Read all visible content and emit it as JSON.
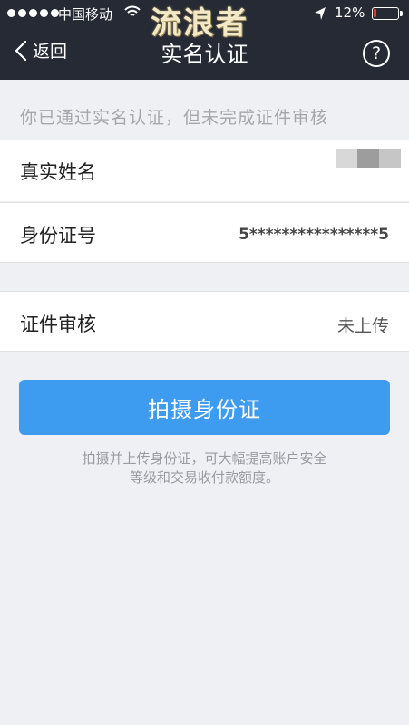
{
  "status_bar": {
    "carrier": "中国移动",
    "battery_percent": "12%",
    "battery_level": 0.12,
    "watermark": "流浪者"
  },
  "nav": {
    "back_label": "返回",
    "title": "实名认证",
    "help_symbol": "?"
  },
  "notice": "你已通过实名认证，但未完成证件审核",
  "info": {
    "name_label": "真实姓名",
    "id_label": "身份证号",
    "id_value": "5****************5",
    "verify_label": "证件审核",
    "verify_value": "未上传"
  },
  "action": {
    "button_label": "拍摄身份证",
    "hint_line1": "拍摄并上传身份证，可大幅提高账户安全",
    "hint_line2": "等级和交易收付款额度。"
  },
  "colors": {
    "header_bg": "#262a35",
    "accent": "#3d9bf0",
    "battery_low": "#e63a2e",
    "page_bg": "#eff0f4"
  },
  "icons": [
    "signal-icon",
    "wifi-icon",
    "location-arrow-icon",
    "battery-icon",
    "back-chevron-icon",
    "help-icon"
  ]
}
